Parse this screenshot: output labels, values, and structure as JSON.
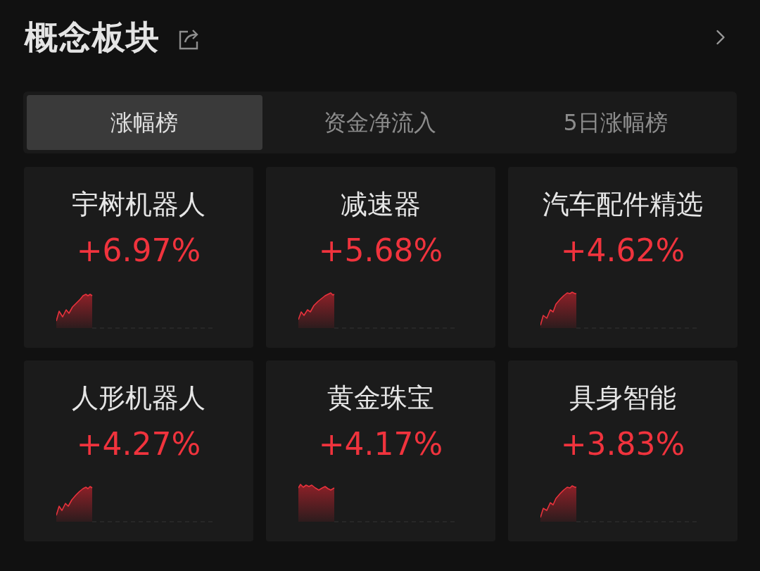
{
  "header": {
    "title": "概念板块"
  },
  "tabs": [
    {
      "label": "涨幅榜",
      "selected": true
    },
    {
      "label": "资金净流入",
      "selected": false
    },
    {
      "label": "5日涨幅榜",
      "selected": false
    }
  ],
  "sectors": [
    {
      "name": "宇树机器人",
      "change": "+6.97%"
    },
    {
      "name": "减速器",
      "change": "+5.68%"
    },
    {
      "name": "汽车配件精选",
      "change": "+4.62%"
    },
    {
      "name": "人形机器人",
      "change": "+4.27%"
    },
    {
      "name": "黄金珠宝",
      "change": "+4.17%"
    },
    {
      "name": "具身智能",
      "change": "+3.83%"
    }
  ]
}
